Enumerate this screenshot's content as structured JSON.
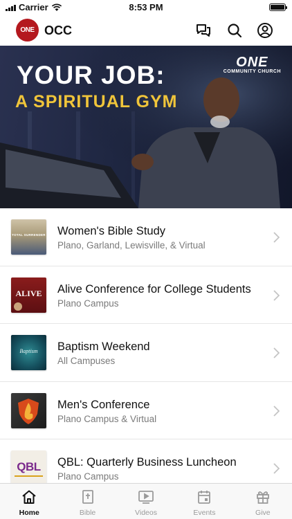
{
  "status_bar": {
    "carrier": "Carrier",
    "time": "8:53 PM"
  },
  "header": {
    "logo_text": "ONE",
    "title": "OCC"
  },
  "hero": {
    "line1": "YOUR JOB:",
    "line2": "A SPIRITUAL GYM",
    "brand": "ONE",
    "brand_sub": "COMMUNITY CHURCH"
  },
  "events": [
    {
      "title": "Women's Bible Study",
      "subtitle": "Plano, Garland, Lewisville, & Virtual",
      "thumb_text": "TOTAL SURRENDER"
    },
    {
      "title": "Alive Conference for College Students",
      "subtitle": "Plano Campus",
      "thumb_text": "ALIVE"
    },
    {
      "title": "Baptism Weekend",
      "subtitle": "All Campuses",
      "thumb_text": "Baptism"
    },
    {
      "title": "Men's Conference",
      "subtitle": "Plano Campus & Virtual",
      "thumb_text": ""
    },
    {
      "title": "QBL: Quarterly Business Luncheon",
      "subtitle": "Plano Campus",
      "thumb_text": "QBL"
    }
  ],
  "tabs": [
    {
      "label": "Home",
      "icon": "home-icon",
      "active": true
    },
    {
      "label": "Bible",
      "icon": "bible-icon",
      "active": false
    },
    {
      "label": "Videos",
      "icon": "videos-icon",
      "active": false
    },
    {
      "label": "Events",
      "icon": "events-icon",
      "active": false
    },
    {
      "label": "Give",
      "icon": "give-icon",
      "active": false
    }
  ],
  "colors": {
    "brand_red": "#b4181e",
    "hero_gold": "#f0c53a",
    "tab_active": "#111111",
    "tab_inactive": "#9a9a9a"
  }
}
